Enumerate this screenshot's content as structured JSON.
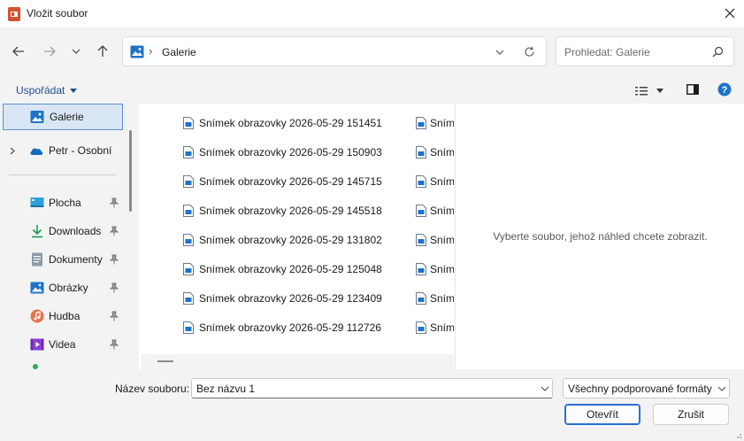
{
  "window": {
    "title": "Vložit soubor",
    "close_icon": "close-icon",
    "app_icon": "powerpoint-icon"
  },
  "address": {
    "location_icon": "gallery-icon",
    "separator": "›",
    "current": "Galerie"
  },
  "search": {
    "placeholder": "Prohledat: Galerie"
  },
  "toolbar": {
    "organize_label": "Uspořádat"
  },
  "sidebar": {
    "items": [
      {
        "label": "Galerie",
        "icon": "gallery-icon",
        "selected": true
      },
      {
        "label": "Petr - Osobní",
        "icon": "onedrive-icon"
      },
      {
        "label": "Plocha",
        "icon": "desktop-icon",
        "pinned": true
      },
      {
        "label": "Downloads",
        "icon": "download-icon",
        "pinned": true
      },
      {
        "label": "Dokumenty",
        "icon": "documents-icon",
        "pinned": true
      },
      {
        "label": "Obrázky",
        "icon": "pictures-icon",
        "pinned": true
      },
      {
        "label": "Hudba",
        "icon": "music-icon",
        "pinned": true
      },
      {
        "label": "Videa",
        "icon": "videos-icon",
        "pinned": true
      }
    ]
  },
  "files": {
    "column1": [
      "Snímek obrazovky 2026-05-29 151451",
      "Snímek obrazovky 2026-05-29 150903",
      "Snímek obrazovky 2026-05-29 145715",
      "Snímek obrazovky 2026-05-29 145518",
      "Snímek obrazovky 2026-05-29 131802",
      "Snímek obrazovky 2026-05-29 125048",
      "Snímek obrazovky 2026-05-29 123409",
      "Snímek obrazovky 2026-05-29 112726"
    ],
    "column2_truncated": [
      "Sním",
      "Sním",
      "Sním",
      "Sním",
      "Sním",
      "Sním",
      "Sním",
      "Sním"
    ]
  },
  "preview": {
    "empty_text": "Vyberte soubor, jehož náhled chcete zobrazit."
  },
  "footer": {
    "filename_label": "Název souboru:",
    "filename_value": "Bez názvu 1",
    "filter_value": "Všechny podporované formáty",
    "open_label": "Otevřít",
    "cancel_label": "Zrušit"
  },
  "colors": {
    "accent": "#2a6fd0",
    "selection": "#d9e6f5",
    "chrome": "#f3f3f3"
  }
}
